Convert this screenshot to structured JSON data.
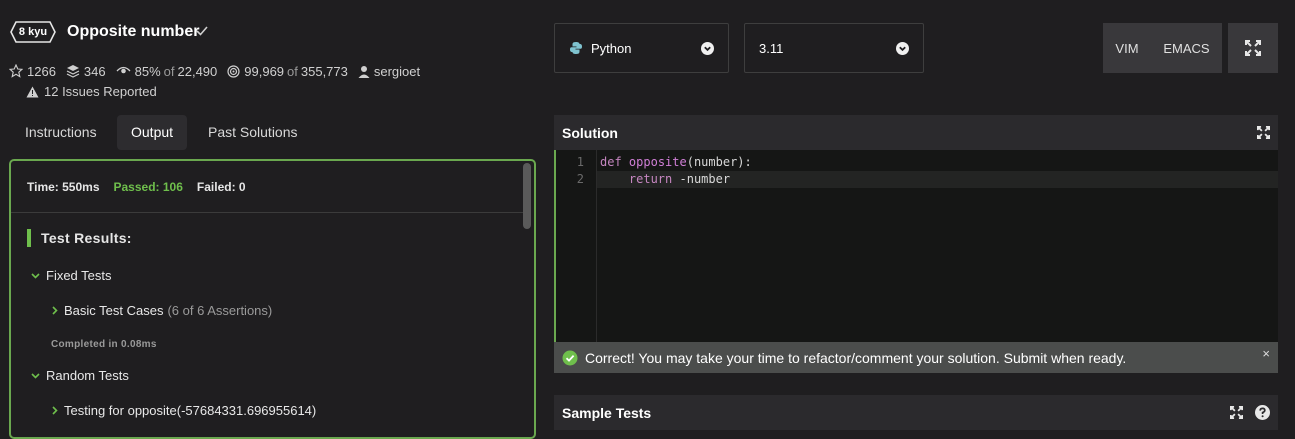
{
  "kata": {
    "rank": "8 kyu",
    "title": "Opposite number",
    "stats": {
      "stars": "1266",
      "collections": "346",
      "satisfaction": "85%",
      "satisfaction_of": "of",
      "votes": "22,490",
      "completed": "99,969",
      "completed_of": "of",
      "attempts": "355,773",
      "author": "sergioet"
    },
    "issues": "12 Issues Reported"
  },
  "tabs": [
    {
      "label": "Instructions"
    },
    {
      "label": "Output"
    },
    {
      "label": "Past Solutions"
    }
  ],
  "output": {
    "time": "Time: 550ms",
    "passed": "Passed: 106",
    "failed": "Failed: 0",
    "results_title": "Test Results:",
    "groups": [
      {
        "label": "Fixed Tests"
      },
      {
        "label": "Basic Test Cases",
        "assertions": "(6 of 6 Assertions)",
        "completed": "Completed in 0.08ms"
      },
      {
        "label": "Random Tests"
      },
      {
        "label": "Testing for opposite(-57684331.696955614)"
      }
    ]
  },
  "language": {
    "selected": "Python"
  },
  "version": {
    "selected": "3.11"
  },
  "editor_modes": [
    "VIM",
    "EMACS"
  ],
  "solution": {
    "title": "Solution",
    "lines": [
      {
        "num": "1",
        "kw": "def",
        "fn": "opposite",
        "rest": "(number):"
      },
      {
        "num": "2",
        "kw": "return",
        "rest": " -number"
      }
    ]
  },
  "notice": {
    "text": "Correct! You may take your time to refactor/comment your solution. Submit when ready.",
    "close": "×"
  },
  "sample_tests": {
    "title": "Sample Tests"
  },
  "colors": {
    "accent_green": "#6aa84f",
    "passed": "#6fbf4c",
    "background": "#1f1e20"
  },
  "icons": [
    "star-icon",
    "layers-icon",
    "eye-icon",
    "target-icon",
    "user-icon",
    "warning-icon",
    "check-icon",
    "python-icon",
    "chevron-down-icon",
    "fullscreen-icon",
    "help-icon",
    "check-circle-icon",
    "close-icon"
  ]
}
